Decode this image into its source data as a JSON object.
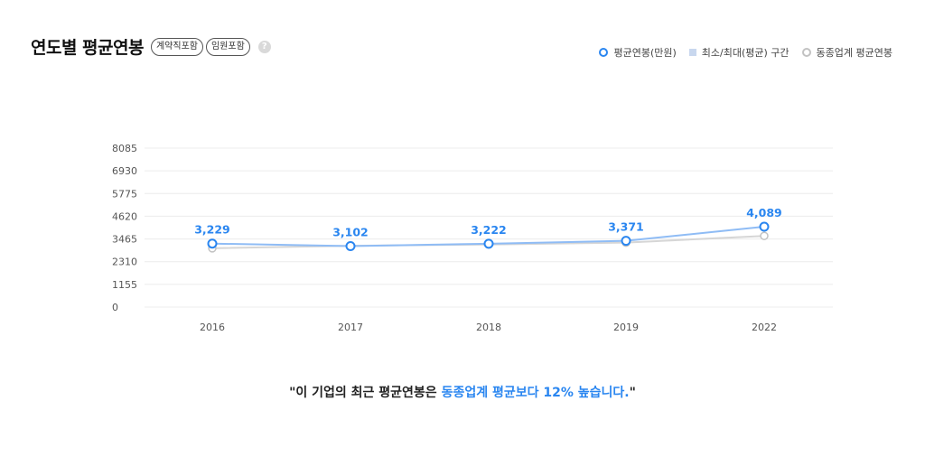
{
  "header": {
    "title": "연도별 평균연봉",
    "tags": [
      "계약직포함",
      "임원포함"
    ],
    "help_glyph": "?"
  },
  "legend": {
    "items": [
      "평균연봉(만원)",
      "최소/최대(평균) 구간",
      "동종업계 평균연봉"
    ]
  },
  "colors": {
    "company": "#2a86f0",
    "company_line": "#8fbcf5",
    "industry": "#c2c2c2",
    "range": "#c8d7ee",
    "grid": "#ececec",
    "tick_text": "#555555"
  },
  "chart_data": {
    "type": "line",
    "categories": [
      "2016",
      "2017",
      "2018",
      "2019",
      "2022"
    ],
    "ylim": [
      0,
      8085
    ],
    "yticks": [
      0,
      1155,
      2310,
      3465,
      4620,
      5775,
      6930,
      8085
    ],
    "series": [
      {
        "name": "평균연봉(만원)",
        "values": [
          3229,
          3102,
          3222,
          3371,
          4089
        ],
        "labels": [
          "3,229",
          "3,102",
          "3,222",
          "3,371",
          "4,089"
        ]
      },
      {
        "name": "동종업계 평균연봉",
        "values": [
          2990,
          3120,
          3180,
          3280,
          3620
        ]
      }
    ]
  },
  "caption": {
    "prefix": "\"이 기업의 최근 평균연봉은 ",
    "highlight": "동종업계 평균보다 12% 높습니다.",
    "suffix": "\""
  }
}
